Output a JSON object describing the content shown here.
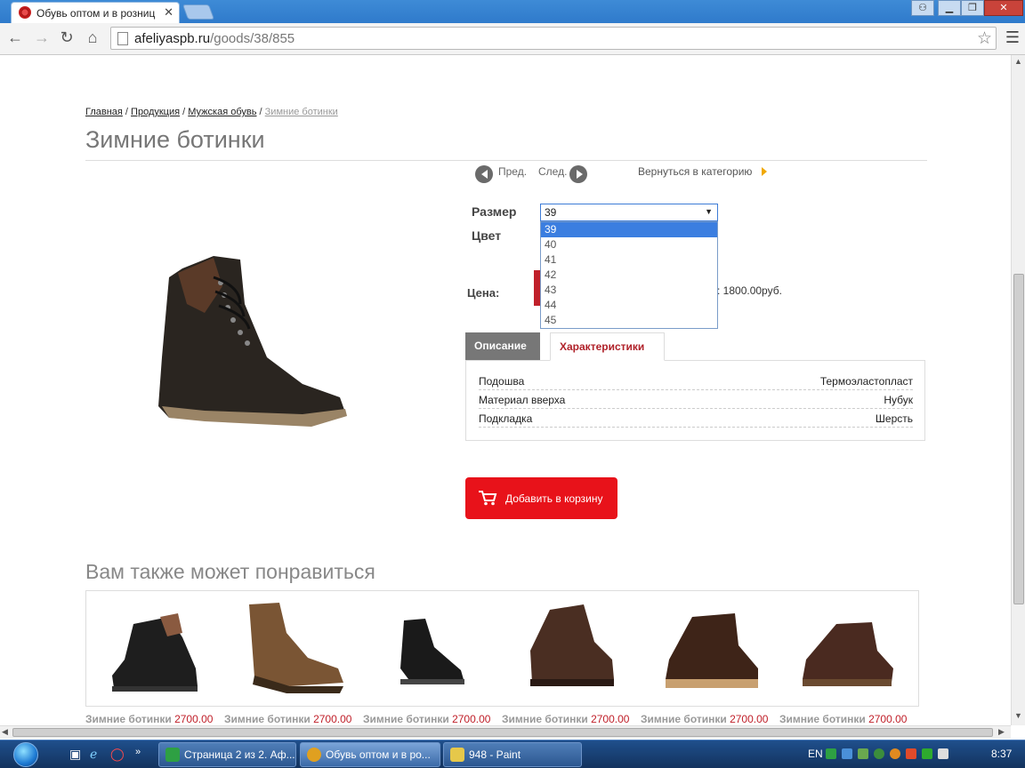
{
  "browser": {
    "tab_title": "Обувь оптом и в розниц",
    "tab_close": "✕",
    "url_host": "afeliyaspb.ru",
    "url_path": "/goods/38/855"
  },
  "page": {
    "breadcrumb": [
      "Главная",
      "Продукция",
      "Мужская обувь",
      "Зимние ботинки"
    ],
    "title": "Зимние ботинки",
    "prev_label": "Пред.",
    "next_label": "След.",
    "back_to_category": "Вернуться в категорию",
    "size_label": "Размер",
    "color_label": "Цвет",
    "price_label": "Цена:",
    "price_text": ": 1800.00руб.",
    "size_select": {
      "selected": "39",
      "options": [
        "39",
        "40",
        "41",
        "42",
        "43",
        "44",
        "45"
      ]
    },
    "tabs": {
      "description": "Описание",
      "characteristics": "Характеристики"
    },
    "characteristics": [
      {
        "name": "Подошва",
        "value": "Термоэластопласт"
      },
      {
        "name": "Материал вверха",
        "value": "Нубук"
      },
      {
        "name": "Подкладка",
        "value": "Шерсть"
      }
    ],
    "add_to_cart": "Добавить в корзину",
    "also_like_title": "Вам также может понравиться",
    "also_like": [
      {
        "name": "Зимние ботинки",
        "price": "2700.00"
      },
      {
        "name": "Зимние ботинки",
        "price": "2700.00"
      },
      {
        "name": "Зимние ботинки",
        "price": "2700.00"
      },
      {
        "name": "Зимние ботинки",
        "price": "2700.00"
      },
      {
        "name": "Зимние ботинки",
        "price": "2700.00"
      },
      {
        "name": "Зимние ботинки",
        "price": "2700.00"
      }
    ]
  },
  "taskbar": {
    "tasks": [
      {
        "label": "Страница 2 из 2. Аф...",
        "icon_color": "#2ea043"
      },
      {
        "label": "Обувь оптом и в ро...",
        "icon_color": "#e0a020"
      },
      {
        "label": "948 - Paint",
        "icon_color": "#e6c84a"
      }
    ],
    "language": "EN",
    "clock": "8:37"
  },
  "colors": {
    "accent_red": "#e8121a",
    "price_red": "#c0202a",
    "link_title_gray": "#777777"
  }
}
